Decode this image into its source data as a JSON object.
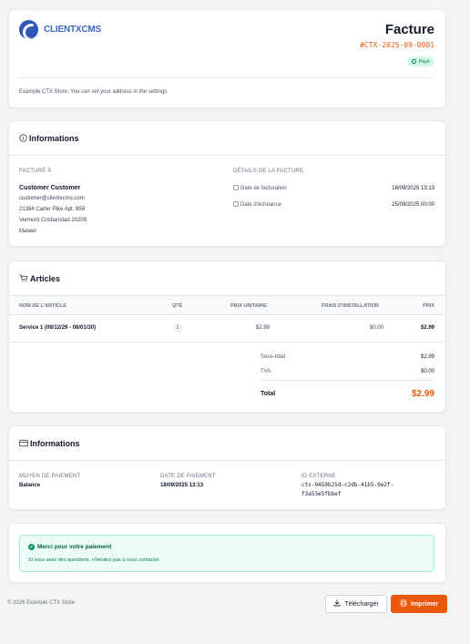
{
  "brand": {
    "logo_text": "CLIENTXCMS",
    "accent": "#ea580c",
    "logo_color": "#2e57b8"
  },
  "invoice": {
    "title": "Facture",
    "number": "#CTX-2025-09-0001",
    "status": "Payé",
    "address_note": "Example CTX Store, You can set your address in the settings"
  },
  "info": {
    "title": "Informations",
    "billed_to_label": "FACTURÉ À",
    "customer_name": "Customer Customer",
    "customer_lines": [
      "customer@clientxcms.com",
      "21384 Carter Pike Apt. 858",
      "Vermont Cristianstad 20209",
      "Malawi"
    ],
    "details_label": "DÉTAILS DE LA FACTURE",
    "details": [
      {
        "label": "Date de facturation",
        "value": "18/09/2025 13:13"
      },
      {
        "label": "Date d'échéance",
        "value": "25/09/2025 00:00"
      }
    ]
  },
  "articles": {
    "title": "Articles",
    "headers": [
      "NOM DE L'ARTICLE",
      "QTÉ",
      "PRIX UNITAIRE",
      "FRAIS D'INSTALLATION",
      "PRIX"
    ],
    "rows": [
      {
        "name": "Service 1 (08/12/29 - 08/01/30)",
        "qty": "1",
        "unit_price": "$2.99",
        "setup_fee": "$0.00",
        "price": "$2.99"
      }
    ],
    "subtotal_label": "Sous-total",
    "subtotal": "$2.99",
    "tax_label": "TVA",
    "tax": "$0.00",
    "total_label": "Total",
    "total": "$2.99"
  },
  "payment": {
    "title": "Informations",
    "method_label": "MOYEN DE PAIEMENT",
    "method": "Balance",
    "date_label": "DATE DE PAIEMENT",
    "date": "18/09/2025 13:13",
    "external_label": "ID EXTERNE",
    "external_id_line1": "ctx-9459b25d-c2db-41b5-9e2f-",
    "external_id_line2": "f3a53e5fbbef"
  },
  "thanks": {
    "title": "Merci pour votre paiement",
    "text": "Si vous avez des questions, n'hésitez pas à nous contacter."
  },
  "footer": {
    "copyright": "© 2026 Example CTX Store",
    "download_label": "Télécharger",
    "print_label": "Imprimer"
  }
}
